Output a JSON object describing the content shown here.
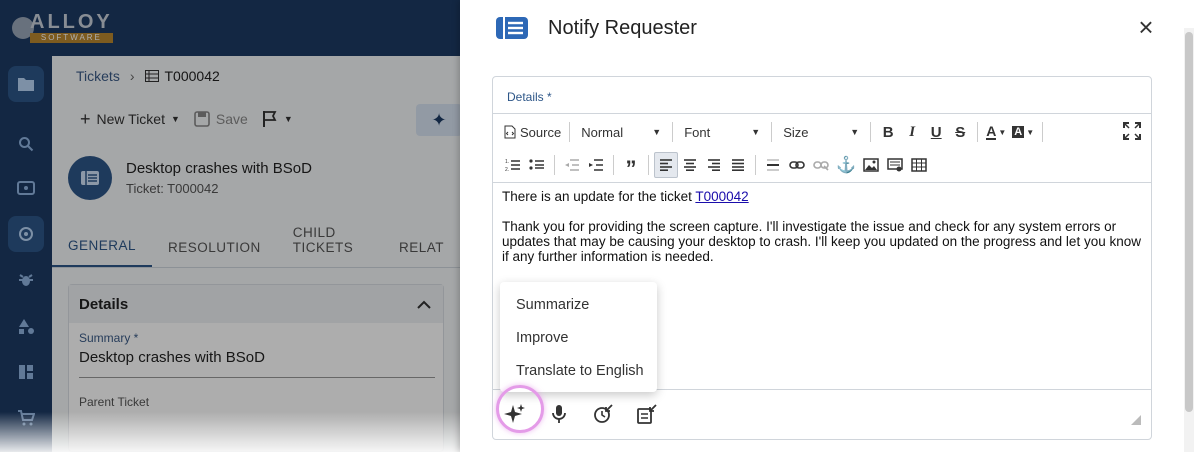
{
  "app": {
    "logo_text": "ALLOY",
    "logo_sub": "SOFTWARE"
  },
  "breadcrumb": {
    "root": "Tickets",
    "separator": "›",
    "current": "T000042"
  },
  "toolbar": {
    "new_ticket": "New Ticket",
    "save": "Save"
  },
  "ticket": {
    "title": "Desktop crashes with BSoD",
    "subtitle": "Ticket: T000042"
  },
  "tabs": [
    "GENERAL",
    "RESOLUTION",
    "CHILD TICKETS",
    "RELAT"
  ],
  "details_card": {
    "title": "Details",
    "summary_label": "Summary *",
    "summary_value": "Desktop crashes with BSoD",
    "parent_label": "Parent Ticket"
  },
  "dialog": {
    "title": "Notify Requester",
    "close": "×",
    "field_label": "Details *",
    "toolbar": {
      "source": "Source",
      "format": "Normal",
      "font": "Font",
      "size": "Size"
    },
    "body": {
      "line1_prefix": "There is an update for the ticket ",
      "line1_link": "T000042",
      "paragraph2": "Thank you for providing the screen capture. I'll investigate the issue and check for any system errors or updates that may be causing your desktop to crash. I'll keep you updated on the progress and let you know if any further information is needed."
    }
  },
  "ai_menu": {
    "items": [
      "Summarize",
      "Improve",
      "Translate to English"
    ]
  },
  "colors": {
    "nav_bg": "#1c3a63",
    "accent": "#2d5688",
    "ai_highlight": "#e49be8",
    "link": "#1a0dab"
  }
}
